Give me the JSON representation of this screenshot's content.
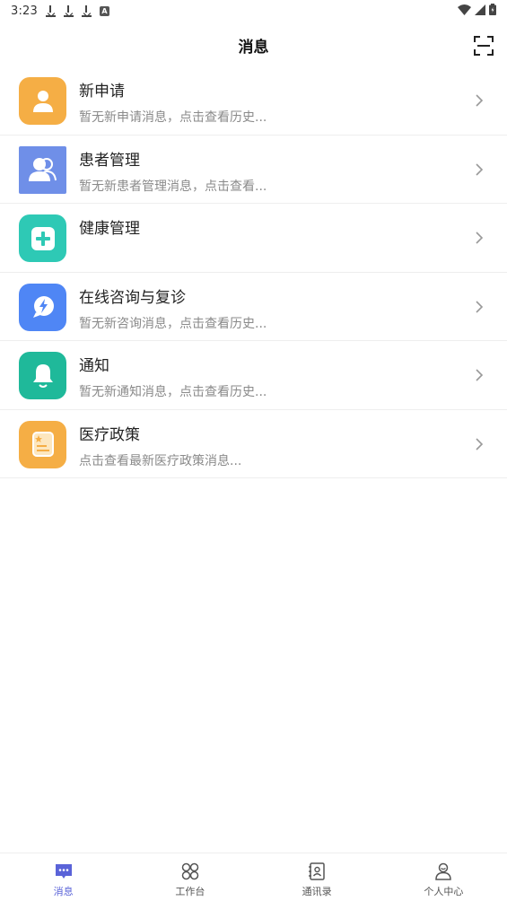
{
  "status_bar": {
    "time": "3:23",
    "icons": [
      "download-icon",
      "download-icon",
      "download-icon",
      "a-badge-icon",
      "wifi-icon",
      "signal-icon",
      "battery-icon"
    ]
  },
  "header": {
    "title": "消息",
    "scan_icon": "scan-icon"
  },
  "messages": [
    {
      "title": "新申请",
      "subtitle": "暂无新申请消息，点击查看历史...",
      "icon": "person-icon",
      "color": "#f5ae45"
    },
    {
      "title": "患者管理",
      "subtitle": "暂无新患者管理消息，点击查看...",
      "icon": "patients-icon",
      "color": "#6f8fe8"
    },
    {
      "title": "健康管理",
      "subtitle": "",
      "icon": "plus-icon",
      "color": "#2ec9b5"
    },
    {
      "title": "在线咨询与复诊",
      "subtitle": "暂无新咨询消息，点击查看历史...",
      "icon": "chat-bolt-icon",
      "color": "#4f86f5"
    },
    {
      "title": "通知",
      "subtitle": "暂无新通知消息，点击查看历史...",
      "icon": "bell-icon",
      "color": "#1fb99a"
    },
    {
      "title": "医疗政策",
      "subtitle": "点击查看最新医疗政策消息...",
      "icon": "policy-icon",
      "color": "#f5ae45"
    }
  ],
  "tabbar": {
    "tabs": [
      {
        "label": "消息",
        "icon": "message-icon",
        "active": true
      },
      {
        "label": "工作台",
        "icon": "workbench-icon",
        "active": false
      },
      {
        "label": "通讯录",
        "icon": "contacts-icon",
        "active": false
      },
      {
        "label": "个人中心",
        "icon": "profile-icon",
        "active": false
      }
    ],
    "active_color": "#5a63d8"
  }
}
